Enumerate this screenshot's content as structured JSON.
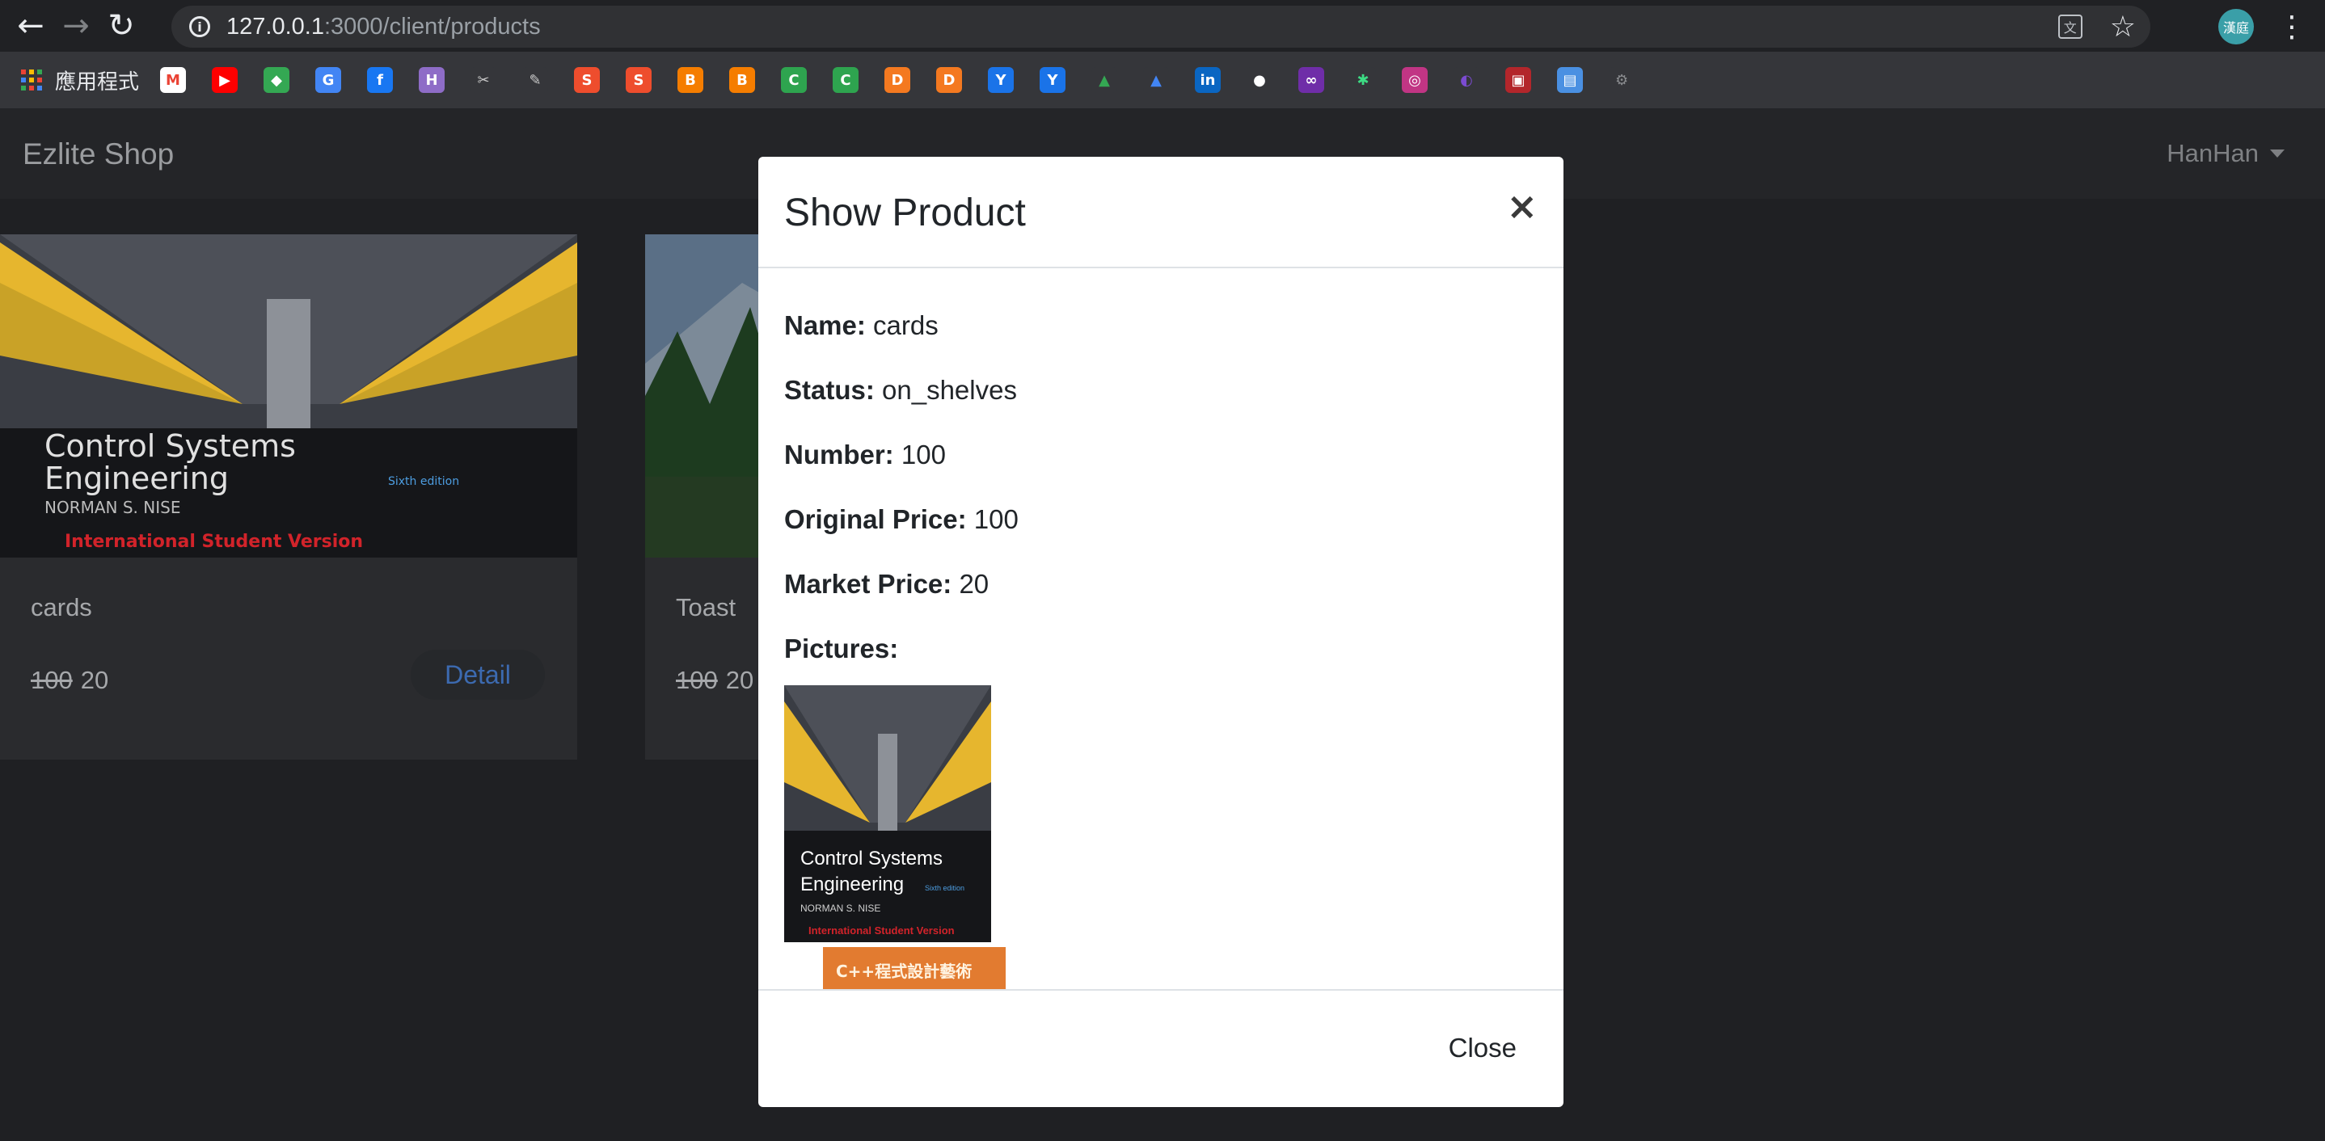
{
  "browser": {
    "url_host": "127.0.0.1",
    "url_path": ":3000/client/products",
    "avatar_text": "漢庭",
    "apps_label": "應用程式",
    "bookmark_icons": [
      {
        "name": "gmail-icon",
        "color": "#ffffff",
        "fg": "#ea4335",
        "glyph": "M"
      },
      {
        "name": "youtube-icon",
        "color": "#ff0000",
        "fg": "#ffffff",
        "glyph": "▶"
      },
      {
        "name": "maps-icon",
        "color": "#34a853",
        "fg": "#ffffff",
        "glyph": "◆"
      },
      {
        "name": "translate-icon",
        "color": "#4285f4",
        "fg": "#ffffff",
        "glyph": "G"
      },
      {
        "name": "facebook-icon",
        "color": "#1877f2",
        "fg": "#ffffff",
        "glyph": "f"
      },
      {
        "name": "hackmd-icon",
        "color": "#8e6cc7",
        "fg": "#ffffff",
        "glyph": "H"
      },
      {
        "name": "tool-icon",
        "color": "#35363a",
        "fg": "#c9c9c9",
        "glyph": "✂"
      },
      {
        "name": "tool-icon-2",
        "color": "#35363a",
        "fg": "#c9c9c9",
        "glyph": "✎"
      },
      {
        "name": "shopee-icon",
        "color": "#ee4d2d",
        "fg": "#ffffff",
        "glyph": "S"
      },
      {
        "name": "shopee-icon-2",
        "color": "#ee4d2d",
        "fg": "#ffffff",
        "glyph": "S"
      },
      {
        "name": "blogger-icon",
        "color": "#f57d00",
        "fg": "#ffffff",
        "glyph": "B"
      },
      {
        "name": "blogger-icon-2",
        "color": "#f57d00",
        "fg": "#ffffff",
        "glyph": "B"
      },
      {
        "name": "codepen-c-icon",
        "color": "#2ea44f",
        "fg": "#ffffff",
        "glyph": "C"
      },
      {
        "name": "codepen-c-icon-2",
        "color": "#2ea44f",
        "fg": "#ffffff",
        "glyph": "C"
      },
      {
        "name": "dx-icon",
        "color": "#f47920",
        "fg": "#ffffff",
        "glyph": "D"
      },
      {
        "name": "dx-icon-2",
        "color": "#f47920",
        "fg": "#ffffff",
        "glyph": "D"
      },
      {
        "name": "yahoo-icon",
        "color": "#1a73e8",
        "fg": "#ffffff",
        "glyph": "Y"
      },
      {
        "name": "yahoo-icon-2",
        "color": "#1a73e8",
        "fg": "#ffffff",
        "glyph": "Y"
      },
      {
        "name": "drive-icon",
        "color": "#35363a",
        "fg": "#34a853",
        "glyph": "▲"
      },
      {
        "name": "drive-icon-2",
        "color": "#35363a",
        "fg": "#4285f4",
        "glyph": "▲"
      },
      {
        "name": "linkedin-icon",
        "color": "#0a66c2",
        "fg": "#ffffff",
        "glyph": "in"
      },
      {
        "name": "github-icon",
        "color": "#35363a",
        "fg": "#ffffff",
        "glyph": "●"
      },
      {
        "name": "ruby-icon",
        "color": "#6f2da8",
        "fg": "#ffffff",
        "glyph": "∞"
      },
      {
        "name": "green-star-icon",
        "color": "#35363a",
        "fg": "#3ddc84",
        "glyph": "✱"
      },
      {
        "name": "instagram-icon",
        "color": "#c13584",
        "fg": "#ffffff",
        "glyph": "◎"
      },
      {
        "name": "purple-swirl-icon",
        "color": "#35363a",
        "fg": "#7b4bd1",
        "glyph": "◐"
      },
      {
        "name": "red-box-icon",
        "color": "#b3262b",
        "fg": "#ffffff",
        "glyph": "▣"
      },
      {
        "name": "blue-box-icon",
        "color": "#4a90e2",
        "fg": "#ffffff",
        "glyph": "▤"
      },
      {
        "name": "extension-icon",
        "color": "#35363a",
        "fg": "#8a8c8f",
        "glyph": "⚙"
      }
    ]
  },
  "navbar": {
    "brand": "Ezlite Shop",
    "user": "HanHan"
  },
  "products": [
    {
      "title": "cards",
      "original_price": "100",
      "market_price": "20",
      "detail_label": "Detail"
    },
    {
      "title": "Toast",
      "original_price": "100",
      "market_price": "20"
    }
  ],
  "modal": {
    "title": "Show Product",
    "close_x": "×",
    "fields": [
      {
        "label": "Name:",
        "value": "cards"
      },
      {
        "label": "Status:",
        "value": "on_shelves"
      },
      {
        "label": "Number:",
        "value": "100"
      },
      {
        "label": "Original Price:",
        "value": "100"
      },
      {
        "label": "Market Price:",
        "value": "20"
      },
      {
        "label": "Pictures:",
        "value": ""
      }
    ],
    "book_cover": {
      "title_line1": "Control Systems",
      "title_line2": "Engineering",
      "edition": "Sixth edition",
      "author": "NORMAN S. NISE",
      "version": "International Student Version"
    },
    "second_picture_text": "C++程式設計藝術",
    "close_button": "Close"
  },
  "colors": {
    "accent_link": "#3c6ab0",
    "cover_yellow": "#e6b62e",
    "cover_red": "#d2232a"
  }
}
